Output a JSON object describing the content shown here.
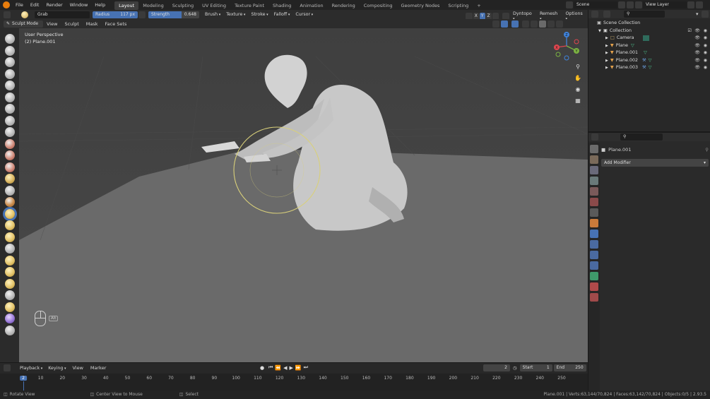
{
  "topbar": {
    "menus": [
      "File",
      "Edit",
      "Render",
      "Window",
      "Help"
    ],
    "workspaces": [
      "Layout",
      "Modeling",
      "Sculpting",
      "UV Editing",
      "Texture Paint",
      "Shading",
      "Animation",
      "Rendering",
      "Compositing",
      "Geometry Nodes",
      "Scripting"
    ],
    "active_workspace": "Layout",
    "add_tab": "+",
    "scene_label": "Scene",
    "view_layer_label": "View Layer"
  },
  "tool_header": {
    "brush_name": "Grab",
    "radius_label": "Radius",
    "radius_value": "117 px",
    "strength_label": "Strength",
    "strength_value": "0.648",
    "strength_fraction": 0.648,
    "dropdowns": [
      "Brush",
      "Texture",
      "Stroke",
      "Falloff",
      "Cursor"
    ],
    "axes": [
      "X",
      "Y",
      "Z"
    ],
    "dyntopo": "Dyntopo",
    "remesh": "Remesh",
    "options": "Options"
  },
  "mode_header": {
    "mode": "Sculpt Mode",
    "menus": [
      "View",
      "Sculpt",
      "Mask",
      "Face Sets"
    ]
  },
  "viewport": {
    "perspective": "User Perspective",
    "object": "(2) Plane.001",
    "gizmo_labels": [
      "X",
      "Y",
      "Z"
    ],
    "mouse_hint": "Alt"
  },
  "timeline": {
    "menus": [
      "Playback",
      "Keying",
      "View",
      "Marker"
    ],
    "current_frame": "2",
    "start_label": "Start",
    "start_value": "1",
    "end_label": "End",
    "end_value": "250",
    "ticks": [
      "2",
      "10",
      "20",
      "30",
      "40",
      "50",
      "60",
      "70",
      "80",
      "90",
      "100",
      "110",
      "120",
      "130",
      "140",
      "150",
      "160",
      "170",
      "180",
      "190",
      "200",
      "210",
      "220",
      "230",
      "240",
      "250"
    ]
  },
  "outliner": {
    "root": "Scene Collection",
    "collection": "Collection",
    "items": [
      {
        "name": "Camera",
        "color": "#c9a86a"
      },
      {
        "name": "Plane",
        "color": "#e3a14c"
      },
      {
        "name": "Plane.001",
        "color": "#e3a14c"
      },
      {
        "name": "Plane.002",
        "color": "#e3a14c"
      },
      {
        "name": "Plane.003",
        "color": "#e3a14c"
      }
    ]
  },
  "properties": {
    "object_name": "Plane.001",
    "add_modifier": "Add Modifier"
  },
  "statusbar": {
    "left": [
      "Rotate View",
      "Center View to Mouse",
      "Select"
    ],
    "right": "Plane.001 | Verts:63,144/70,824 | Faces:63,142/70,824 | Objects:0/5 | 2.93.5"
  },
  "colors": {
    "accent": "#4772b3",
    "brush_circle": "#d9d07a",
    "gizmo_x": "#e0464f",
    "gizmo_y": "#7cb342",
    "gizmo_z": "#3f83dc"
  }
}
